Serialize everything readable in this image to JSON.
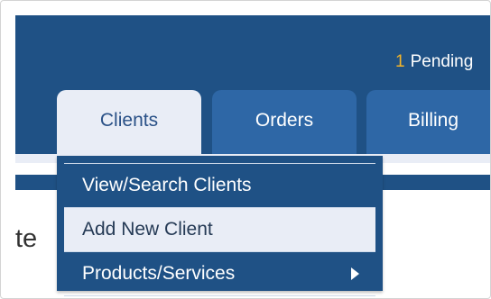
{
  "header": {
    "pending_count": "1",
    "pending_label": "Pending"
  },
  "tabs": [
    {
      "label": "Clients",
      "active": true
    },
    {
      "label": "Orders",
      "active": false
    },
    {
      "label": "Billing",
      "active": false
    }
  ],
  "page": {
    "heading_fragment": "te"
  },
  "clients_menu": {
    "items": [
      {
        "label": "View/Search Clients",
        "highlighted": false
      },
      {
        "label": "Add New Client",
        "highlighted": true
      },
      {
        "label": "Products/Services",
        "highlighted": false,
        "submenu_icon": "caret-right-icon"
      }
    ]
  },
  "colors": {
    "nav_bg": "#1f5185",
    "tab_bg": "#2e67a6",
    "active_tab_bg": "#e9edf6",
    "pending_count": "#f3b429"
  }
}
